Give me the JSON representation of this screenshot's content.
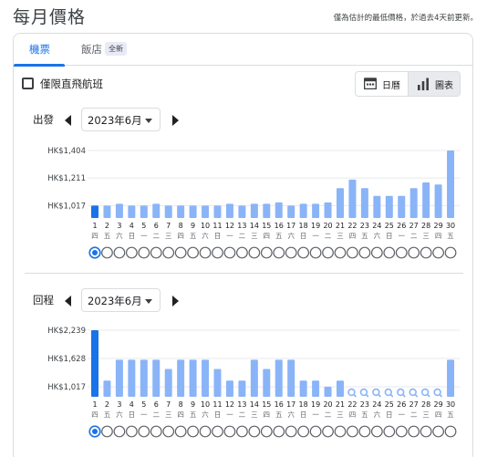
{
  "header": {
    "title": "每月價格",
    "note": "僅為估計的最低價格，於過去4天前更新。"
  },
  "tabs": [
    {
      "label": "機票",
      "active": true
    },
    {
      "label": "飯店",
      "badge": "全新",
      "active": false
    }
  ],
  "filters": {
    "nonstop_label": "僅限直飛航班",
    "nonstop_checked": false
  },
  "view_toggle": {
    "calendar_label": "日曆",
    "chart_label": "圖表",
    "selected": "chart"
  },
  "colors": {
    "accent": "#1a73e8",
    "bar_selected": "#1a73e8",
    "bar": "#8ab4f8",
    "dot_border": "#5f6368",
    "text": "#202124"
  },
  "outbound": {
    "label": "出發",
    "month": "2023年6月"
  },
  "return": {
    "label": "回程",
    "month": "2023年6月"
  },
  "chart_data": [
    {
      "type": "bar",
      "title": "出發",
      "categories": [
        "1",
        "2",
        "3",
        "4",
        "5",
        "6",
        "7",
        "8",
        "9",
        "10",
        "11",
        "12",
        "13",
        "14",
        "15",
        "16",
        "17",
        "18",
        "19",
        "20",
        "21",
        "22",
        "23",
        "24",
        "25",
        "26",
        "27",
        "28",
        "29",
        "30"
      ],
      "weekdays": [
        "四",
        "五",
        "六",
        "日",
        "一",
        "二",
        "三",
        "四",
        "五",
        "六",
        "日",
        "一",
        "二",
        "三",
        "四",
        "五",
        "六",
        "日",
        "一",
        "二",
        "三",
        "四",
        "五",
        "六",
        "日",
        "一",
        "二",
        "三",
        "四",
        "五"
      ],
      "values": [
        1017,
        1017,
        1030,
        1017,
        1017,
        1030,
        1017,
        1017,
        1017,
        1017,
        1017,
        1030,
        1017,
        1030,
        1030,
        1040,
        1017,
        1030,
        1030,
        1040,
        1140,
        1200,
        1140,
        1085,
        1085,
        1085,
        1140,
        1180,
        1165,
        1404
      ],
      "missing": [],
      "selected_index": 0,
      "y_ticks": [
        {
          "value": 1017,
          "label": "HK$1,017"
        },
        {
          "value": 1211,
          "label": "HK$1,211"
        },
        {
          "value": 1404,
          "label": "HK$1,404"
        }
      ],
      "ylim": [
        930,
        1404
      ],
      "grid": true
    },
    {
      "type": "bar",
      "title": "回程",
      "categories": [
        "1",
        "2",
        "3",
        "4",
        "5",
        "6",
        "7",
        "8",
        "9",
        "10",
        "11",
        "12",
        "13",
        "14",
        "15",
        "16",
        "17",
        "18",
        "19",
        "20",
        "21",
        "22",
        "23",
        "24",
        "25",
        "26",
        "27",
        "28",
        "29",
        "30"
      ],
      "weekdays": [
        "四",
        "五",
        "六",
        "日",
        "一",
        "二",
        "三",
        "四",
        "五",
        "六",
        "日",
        "一",
        "二",
        "三",
        "四",
        "五",
        "六",
        "日",
        "一",
        "二",
        "三",
        "四",
        "五",
        "六",
        "日",
        "一",
        "二",
        "三",
        "四",
        "五"
      ],
      "values": [
        2239,
        1150,
        1600,
        1600,
        1600,
        1600,
        1400,
        1600,
        1600,
        1600,
        1400,
        1150,
        1150,
        1600,
        1400,
        1600,
        1600,
        1150,
        1150,
        1017,
        1150,
        null,
        null,
        null,
        null,
        null,
        null,
        null,
        null,
        1600
      ],
      "missing": [
        21,
        22,
        23,
        24,
        25,
        26,
        27,
        28
      ],
      "selected_index": 0,
      "y_ticks": [
        {
          "value": 1017,
          "label": "HK$1,017"
        },
        {
          "value": 1628,
          "label": "HK$1,628"
        },
        {
          "value": 2239,
          "label": "HK$2,239"
        }
      ],
      "ylim": [
        800,
        2239
      ],
      "grid": true
    }
  ]
}
